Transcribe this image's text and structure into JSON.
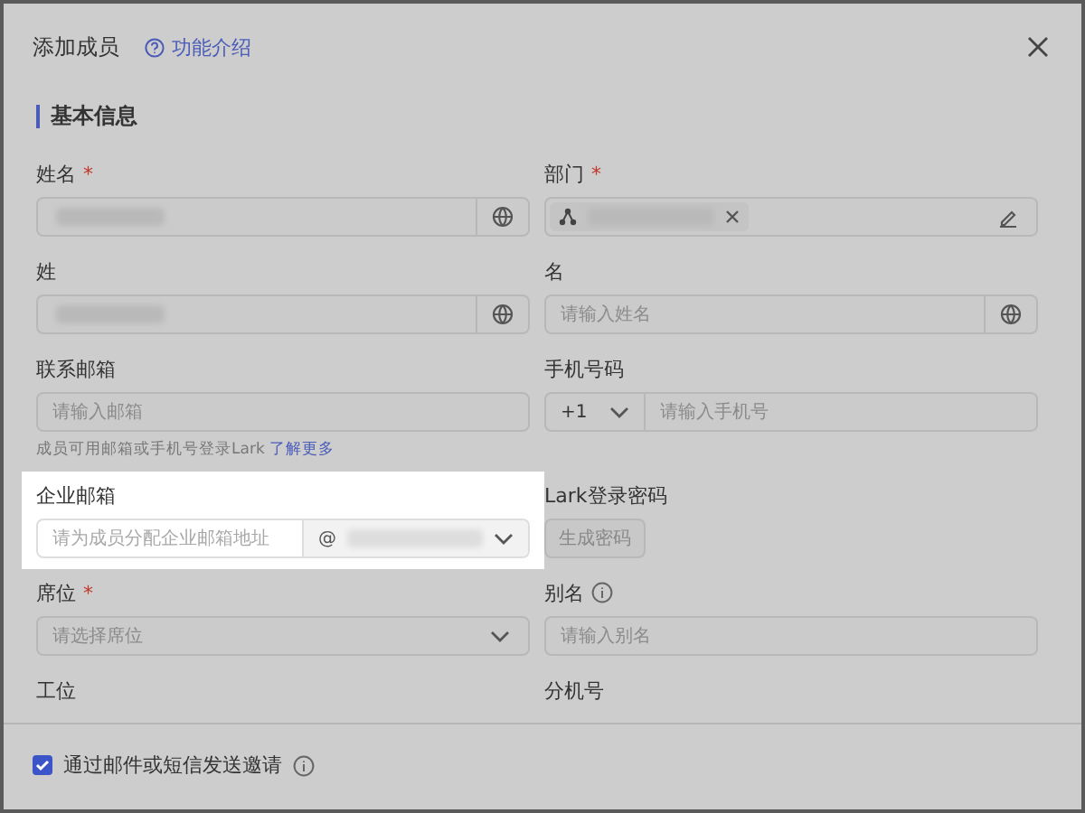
{
  "dialog": {
    "title": "添加成员",
    "help_link": "功能介绍"
  },
  "section": "基本信息",
  "fields": [
    {
      "kind": "text-globe",
      "label": "姓名",
      "required_mark": "*",
      "info": false,
      "masked": true,
      "highlighted": false
    },
    {
      "kind": "dept",
      "label": "部门",
      "required_mark": "*",
      "info": false,
      "masked": true,
      "highlighted": false
    },
    {
      "kind": "text-globe",
      "label": "姓",
      "info": false,
      "masked": true,
      "highlighted": false
    },
    {
      "kind": "text-globe",
      "label": "名",
      "info": false,
      "masked": false,
      "placeholder": "请输入姓名",
      "highlighted": false
    },
    {
      "kind": "text",
      "label": "联系邮箱",
      "info": false,
      "placeholder": "请输入邮箱",
      "hint": "成员可用邮箱或手机号登录Lark",
      "hint_link": "了解更多",
      "highlighted": false
    },
    {
      "kind": "phone",
      "label": "手机号码",
      "info": false,
      "code": "+1",
      "placeholder": "请输入手机号",
      "highlighted": false
    },
    {
      "kind": "email-domain",
      "label": "企业邮箱",
      "info": false,
      "placeholder": "请为成员分配企业邮箱地址",
      "domain": "@",
      "highlighted": true
    },
    {
      "kind": "button",
      "label": "Lark登录密码",
      "info": false,
      "button": "生成密码",
      "disabled": true,
      "highlighted": false
    },
    {
      "kind": "select",
      "label": "席位",
      "required_mark": "*",
      "info": false,
      "placeholder": "请选择席位",
      "highlighted": false
    },
    {
      "kind": "text",
      "label": "别名",
      "info": true,
      "placeholder": "请输入别名",
      "highlighted": false
    },
    {
      "kind": "label",
      "label": "工位",
      "info": false,
      "highlighted": false
    },
    {
      "kind": "label",
      "label": "分机号",
      "info": false,
      "highlighted": false
    }
  ],
  "footer": {
    "invite": {
      "label": "通过邮件或短信发送邀请",
      "checked": true,
      "info": true
    }
  }
}
